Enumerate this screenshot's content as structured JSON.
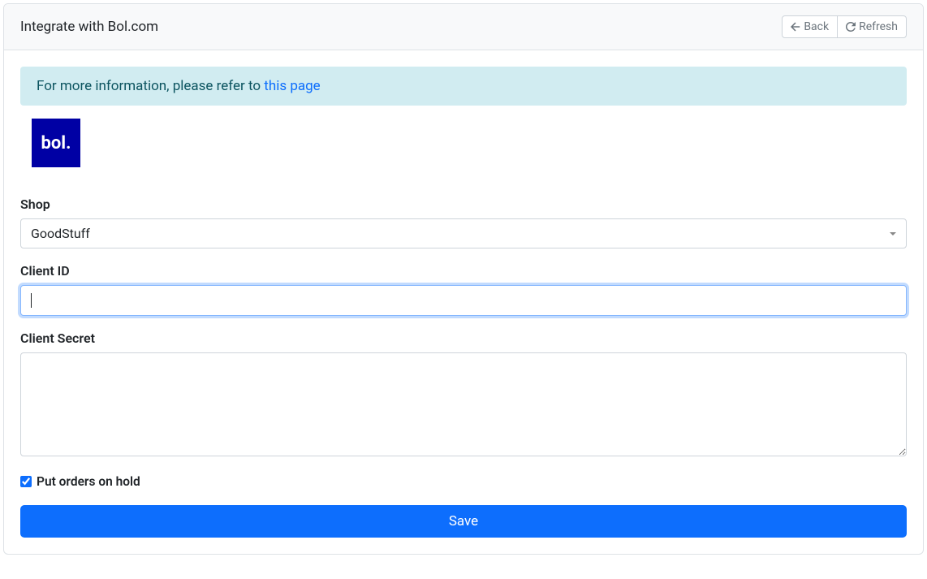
{
  "header": {
    "title": "Integrate with Bol.com",
    "back_label": "Back",
    "refresh_label": "Refresh"
  },
  "alert": {
    "prefix": "For more information, please refer to ",
    "link_text": "this page"
  },
  "logo": {
    "text": "bol."
  },
  "form": {
    "shop": {
      "label": "Shop",
      "selected": "GoodStuff"
    },
    "client_id": {
      "label": "Client ID",
      "value": ""
    },
    "client_secret": {
      "label": "Client Secret",
      "value": ""
    },
    "hold": {
      "label": "Put orders on hold",
      "checked": true
    },
    "save_label": "Save"
  }
}
